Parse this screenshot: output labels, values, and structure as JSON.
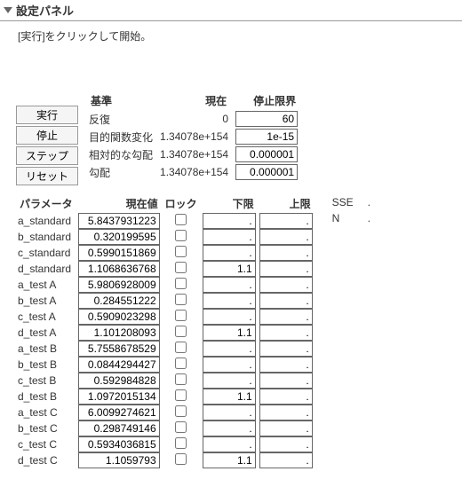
{
  "panel": {
    "title": "設定パネル",
    "instruction": "[実行]をクリックして開始。"
  },
  "buttons": {
    "go": "実行",
    "stop": "停止",
    "step": "ステップ",
    "reset": "リセット"
  },
  "criteria": {
    "headers": {
      "criterion": "基準",
      "current": "現在",
      "stop_limit": "停止限界"
    },
    "rows": [
      {
        "label": "反復",
        "current": "0",
        "limit": "60"
      },
      {
        "label": "目的関数変化",
        "current": "1.34078e+154",
        "limit": "1e-15"
      },
      {
        "label": "相対的な勾配",
        "current": "1.34078e+154",
        "limit": "0.000001"
      },
      {
        "label": "勾配",
        "current": "1.34078e+154",
        "limit": "0.000001"
      }
    ]
  },
  "params": {
    "headers": {
      "param": "パラメータ",
      "current": "現在値",
      "lock": "ロック",
      "lower": "下限",
      "upper": "上限"
    },
    "rows": [
      {
        "name": "a_standard",
        "value": "5.8437931223",
        "lock": false,
        "lower": ".",
        "upper": "."
      },
      {
        "name": "b_standard",
        "value": "0.320199595",
        "lock": false,
        "lower": ".",
        "upper": "."
      },
      {
        "name": "c_standard",
        "value": "0.5990151869",
        "lock": false,
        "lower": ".",
        "upper": "."
      },
      {
        "name": "d_standard",
        "value": "1.1068636768",
        "lock": false,
        "lower": "1.1",
        "upper": "."
      },
      {
        "name": "a_test A",
        "value": "5.9806928009",
        "lock": false,
        "lower": ".",
        "upper": "."
      },
      {
        "name": "b_test A",
        "value": "0.284551222",
        "lock": false,
        "lower": ".",
        "upper": "."
      },
      {
        "name": "c_test A",
        "value": "0.5909023298",
        "lock": false,
        "lower": ".",
        "upper": "."
      },
      {
        "name": "d_test A",
        "value": "1.101208093",
        "lock": false,
        "lower": "1.1",
        "upper": "."
      },
      {
        "name": "a_test B",
        "value": "5.7558678529",
        "lock": false,
        "lower": ".",
        "upper": "."
      },
      {
        "name": "b_test B",
        "value": "0.0844294427",
        "lock": false,
        "lower": ".",
        "upper": "."
      },
      {
        "name": "c_test B",
        "value": "0.592984828",
        "lock": false,
        "lower": ".",
        "upper": "."
      },
      {
        "name": "d_test B",
        "value": "1.0972015134",
        "lock": false,
        "lower": "1.1",
        "upper": "."
      },
      {
        "name": "a_test C",
        "value": "6.0099274621",
        "lock": false,
        "lower": ".",
        "upper": "."
      },
      {
        "name": "b_test C",
        "value": "0.298749146",
        "lock": false,
        "lower": ".",
        "upper": "."
      },
      {
        "name": "c_test C",
        "value": "0.5934036815",
        "lock": false,
        "lower": ".",
        "upper": "."
      },
      {
        "name": "d_test C",
        "value": "1.1059793",
        "lock": false,
        "lower": "1.1",
        "upper": "."
      }
    ]
  },
  "stats": {
    "rows": [
      {
        "label": "SSE",
        "value": "."
      },
      {
        "label": "N",
        "value": "."
      }
    ]
  }
}
